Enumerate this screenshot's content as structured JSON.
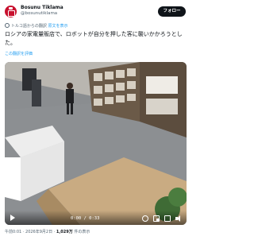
{
  "author": {
    "display_name": "Bosunu Tiklama",
    "handle": "@bosunutiklama",
    "follow_label": "フォロー"
  },
  "translation": {
    "notice": "トルコ語からの翻訳",
    "show_original": "原文を表示",
    "rate_label": "この翻訳を評価"
  },
  "tweet": {
    "text": "ロシアの家電量販店で、ロボットが自分を押した客に襲いかかろうとした。"
  },
  "video": {
    "time_readout": "0:00 / 0:33"
  },
  "meta": {
    "time": "午前0:01",
    "date": "2026年9月2日",
    "views_count": "1,029万",
    "views_suffix": "件の表示",
    "separator": "·"
  },
  "colors": {
    "brand_red": "#c8102e",
    "link_blue": "#1d9bf0",
    "text_gray": "#536471"
  },
  "icons": [
    "globe-icon",
    "play-icon",
    "settings-gear-icon",
    "pip-icon",
    "fullscreen-icon",
    "volume-icon"
  ]
}
